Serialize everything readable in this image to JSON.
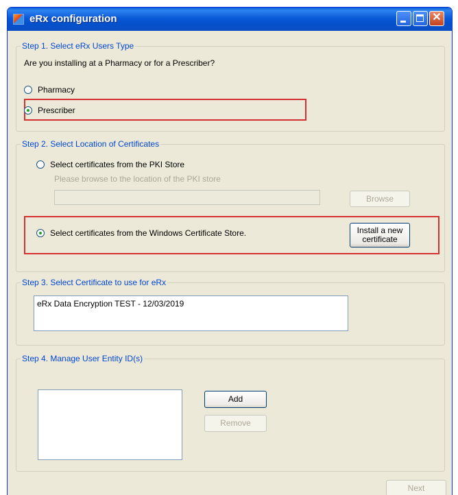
{
  "window": {
    "title": "eRx configuration"
  },
  "step1": {
    "legend": "Step 1.  Select eRx Users Type",
    "question": "Are you installing at a Pharmacy or for a Prescriber?",
    "options": [
      {
        "label": "Pharmacy",
        "checked": false
      },
      {
        "label": "Prescriber",
        "checked": true
      }
    ]
  },
  "step2": {
    "legend": "Step 2. Select Location of Certificates",
    "pki_option": "Select certificates from the PKI Store",
    "pki_hint": "Please browse to the location of the PKI store",
    "pki_path_value": "",
    "browse_label": "Browse",
    "windows_option": "Select certificates from the Windows Certificate Store.",
    "install_label_line1": "Install a new",
    "install_label_line2": "certificate"
  },
  "step3": {
    "legend": "Step 3. Select Certificate to use for eRx",
    "certificates": [
      "eRx Data Encryption TEST - 12/03/2019"
    ]
  },
  "step4": {
    "legend": "Step 4. Manage User Entity ID(s)",
    "entity_ids": [],
    "add_label": "Add",
    "remove_label": "Remove"
  },
  "footer": {
    "next_label": "Next"
  },
  "colors": {
    "title_bar": "#0a59d8",
    "group_title": "#0046d5",
    "highlight": "#d62f2f",
    "window_bg": "#ece9d8"
  }
}
